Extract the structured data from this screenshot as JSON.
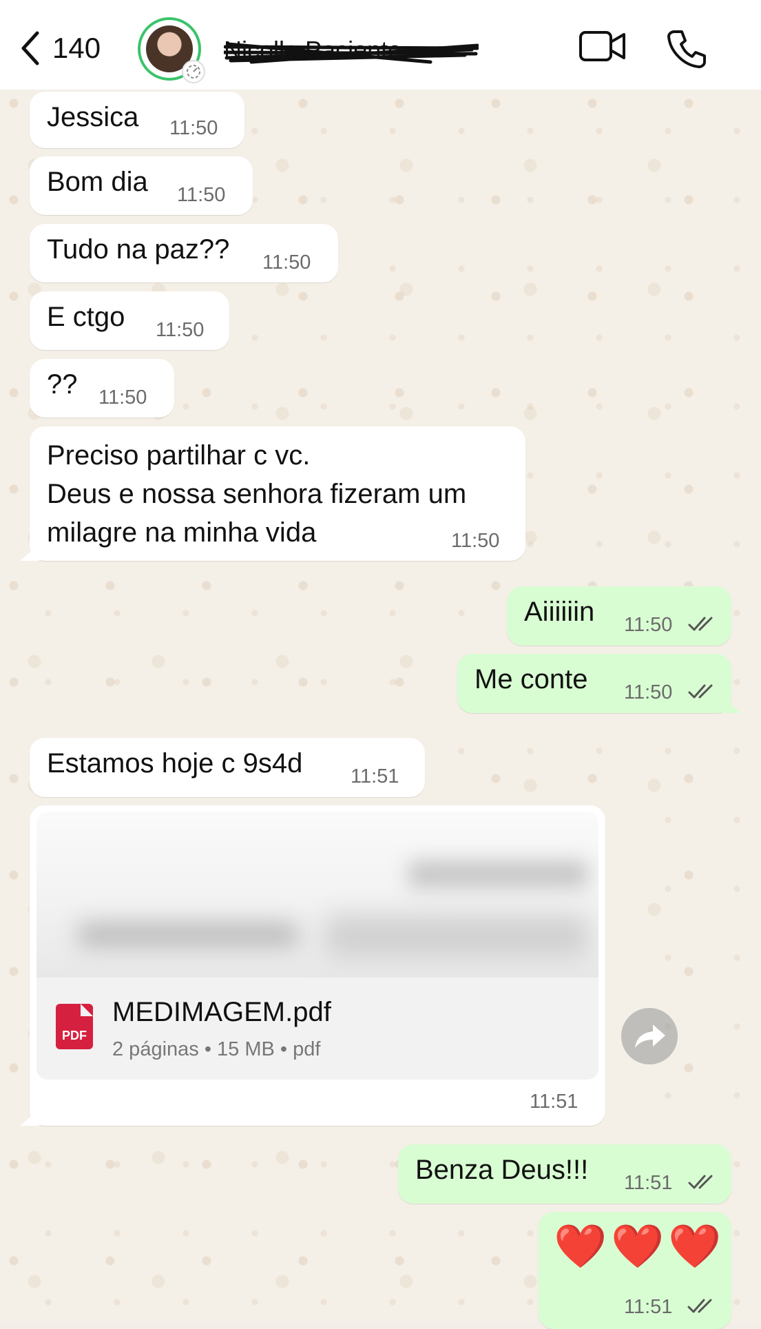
{
  "header": {
    "back_count": "140",
    "contact_name": "Nicolle Paciente"
  },
  "messages": [
    {
      "dir": "in",
      "text": "Jessica",
      "time": "11:50"
    },
    {
      "dir": "in",
      "text": "Bom dia",
      "time": "11:50"
    },
    {
      "dir": "in",
      "text": "Tudo na paz??",
      "time": "11:50"
    },
    {
      "dir": "in",
      "text": "E ctgo",
      "time": "11:50"
    },
    {
      "dir": "in",
      "text": "??",
      "time": "11:50"
    },
    {
      "dir": "in",
      "lines": [
        "Preciso partilhar c vc.",
        "Deus e nossa senhora fizeram um",
        "milagre na minha vida"
      ],
      "time": "11:50"
    },
    {
      "dir": "out",
      "text": "Aiiiiiin",
      "time": "11:50",
      "status": "read"
    },
    {
      "dir": "out",
      "text": "Me conte",
      "time": "11:50",
      "status": "read"
    },
    {
      "dir": "in",
      "text": "Estamos hoje c 9s4d",
      "time": "11:51"
    },
    {
      "dir": "in",
      "document": {
        "name": "MEDIMAGEM.pdf",
        "pages": "2 páginas",
        "size": "15 MB",
        "type": "pdf",
        "icon_label": "PDF"
      },
      "time": "11:51"
    },
    {
      "dir": "out",
      "text": "Benza Deus!!!",
      "time": "11:51",
      "status": "read"
    },
    {
      "dir": "out",
      "text": "❤️❤️❤️",
      "time": "11:51",
      "status": "read"
    }
  ],
  "meta_line": "2 páginas • 15 MB • pdf",
  "colors": {
    "outgoing_bubble": "#d9fdd3",
    "incoming_bubble": "#ffffff",
    "status_ring": "#3ac46a",
    "pdf_icon": "#d6203f"
  },
  "icons": [
    "chevron-left-icon",
    "video-camera-icon",
    "phone-icon",
    "double-check-icon",
    "forward-icon",
    "pdf-file-icon"
  ]
}
